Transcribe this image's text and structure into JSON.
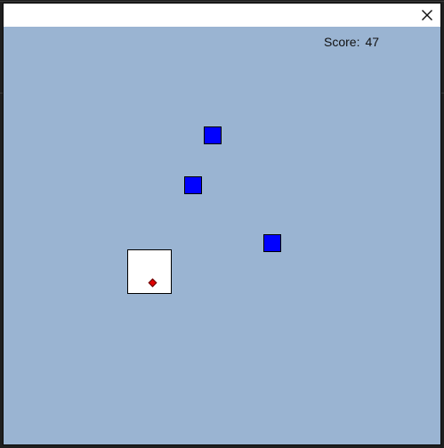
{
  "window": {
    "close_icon": "close-icon",
    "background_color": "#9ab4d2"
  },
  "game": {
    "score_label": "Score:",
    "score_value": "47",
    "enemy_color": "#0000ff",
    "player_color": "#ffffff",
    "player_marker_color": "#e00000"
  }
}
